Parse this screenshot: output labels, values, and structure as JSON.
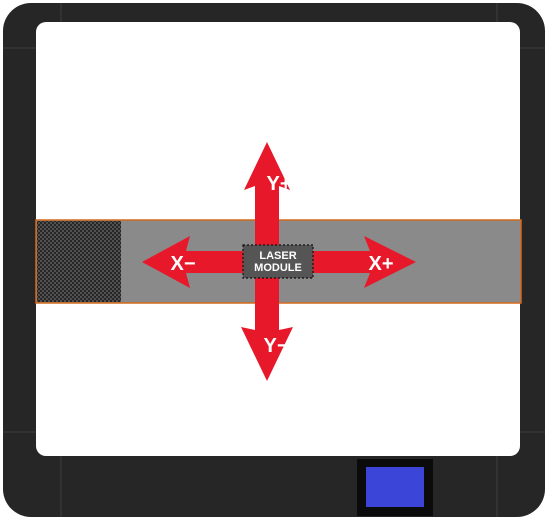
{
  "laser_module": {
    "line1": "LASER",
    "line2": "MODULE"
  },
  "arrows": {
    "y_plus": "Y+",
    "y_minus": "Y−",
    "x_plus": "X+",
    "x_minus": "X−"
  },
  "colors": {
    "frame": "#262626",
    "frame_seam": "#3d3d3d",
    "bed": "#ffffff",
    "rail": "#8a8a8a",
    "rail_edge": "#d4691a",
    "arrow_red": "#e8182b",
    "honeycomb": "#2a2a2a",
    "display_bezel": "#0b0b0b",
    "display_screen": "#3b45d8"
  }
}
